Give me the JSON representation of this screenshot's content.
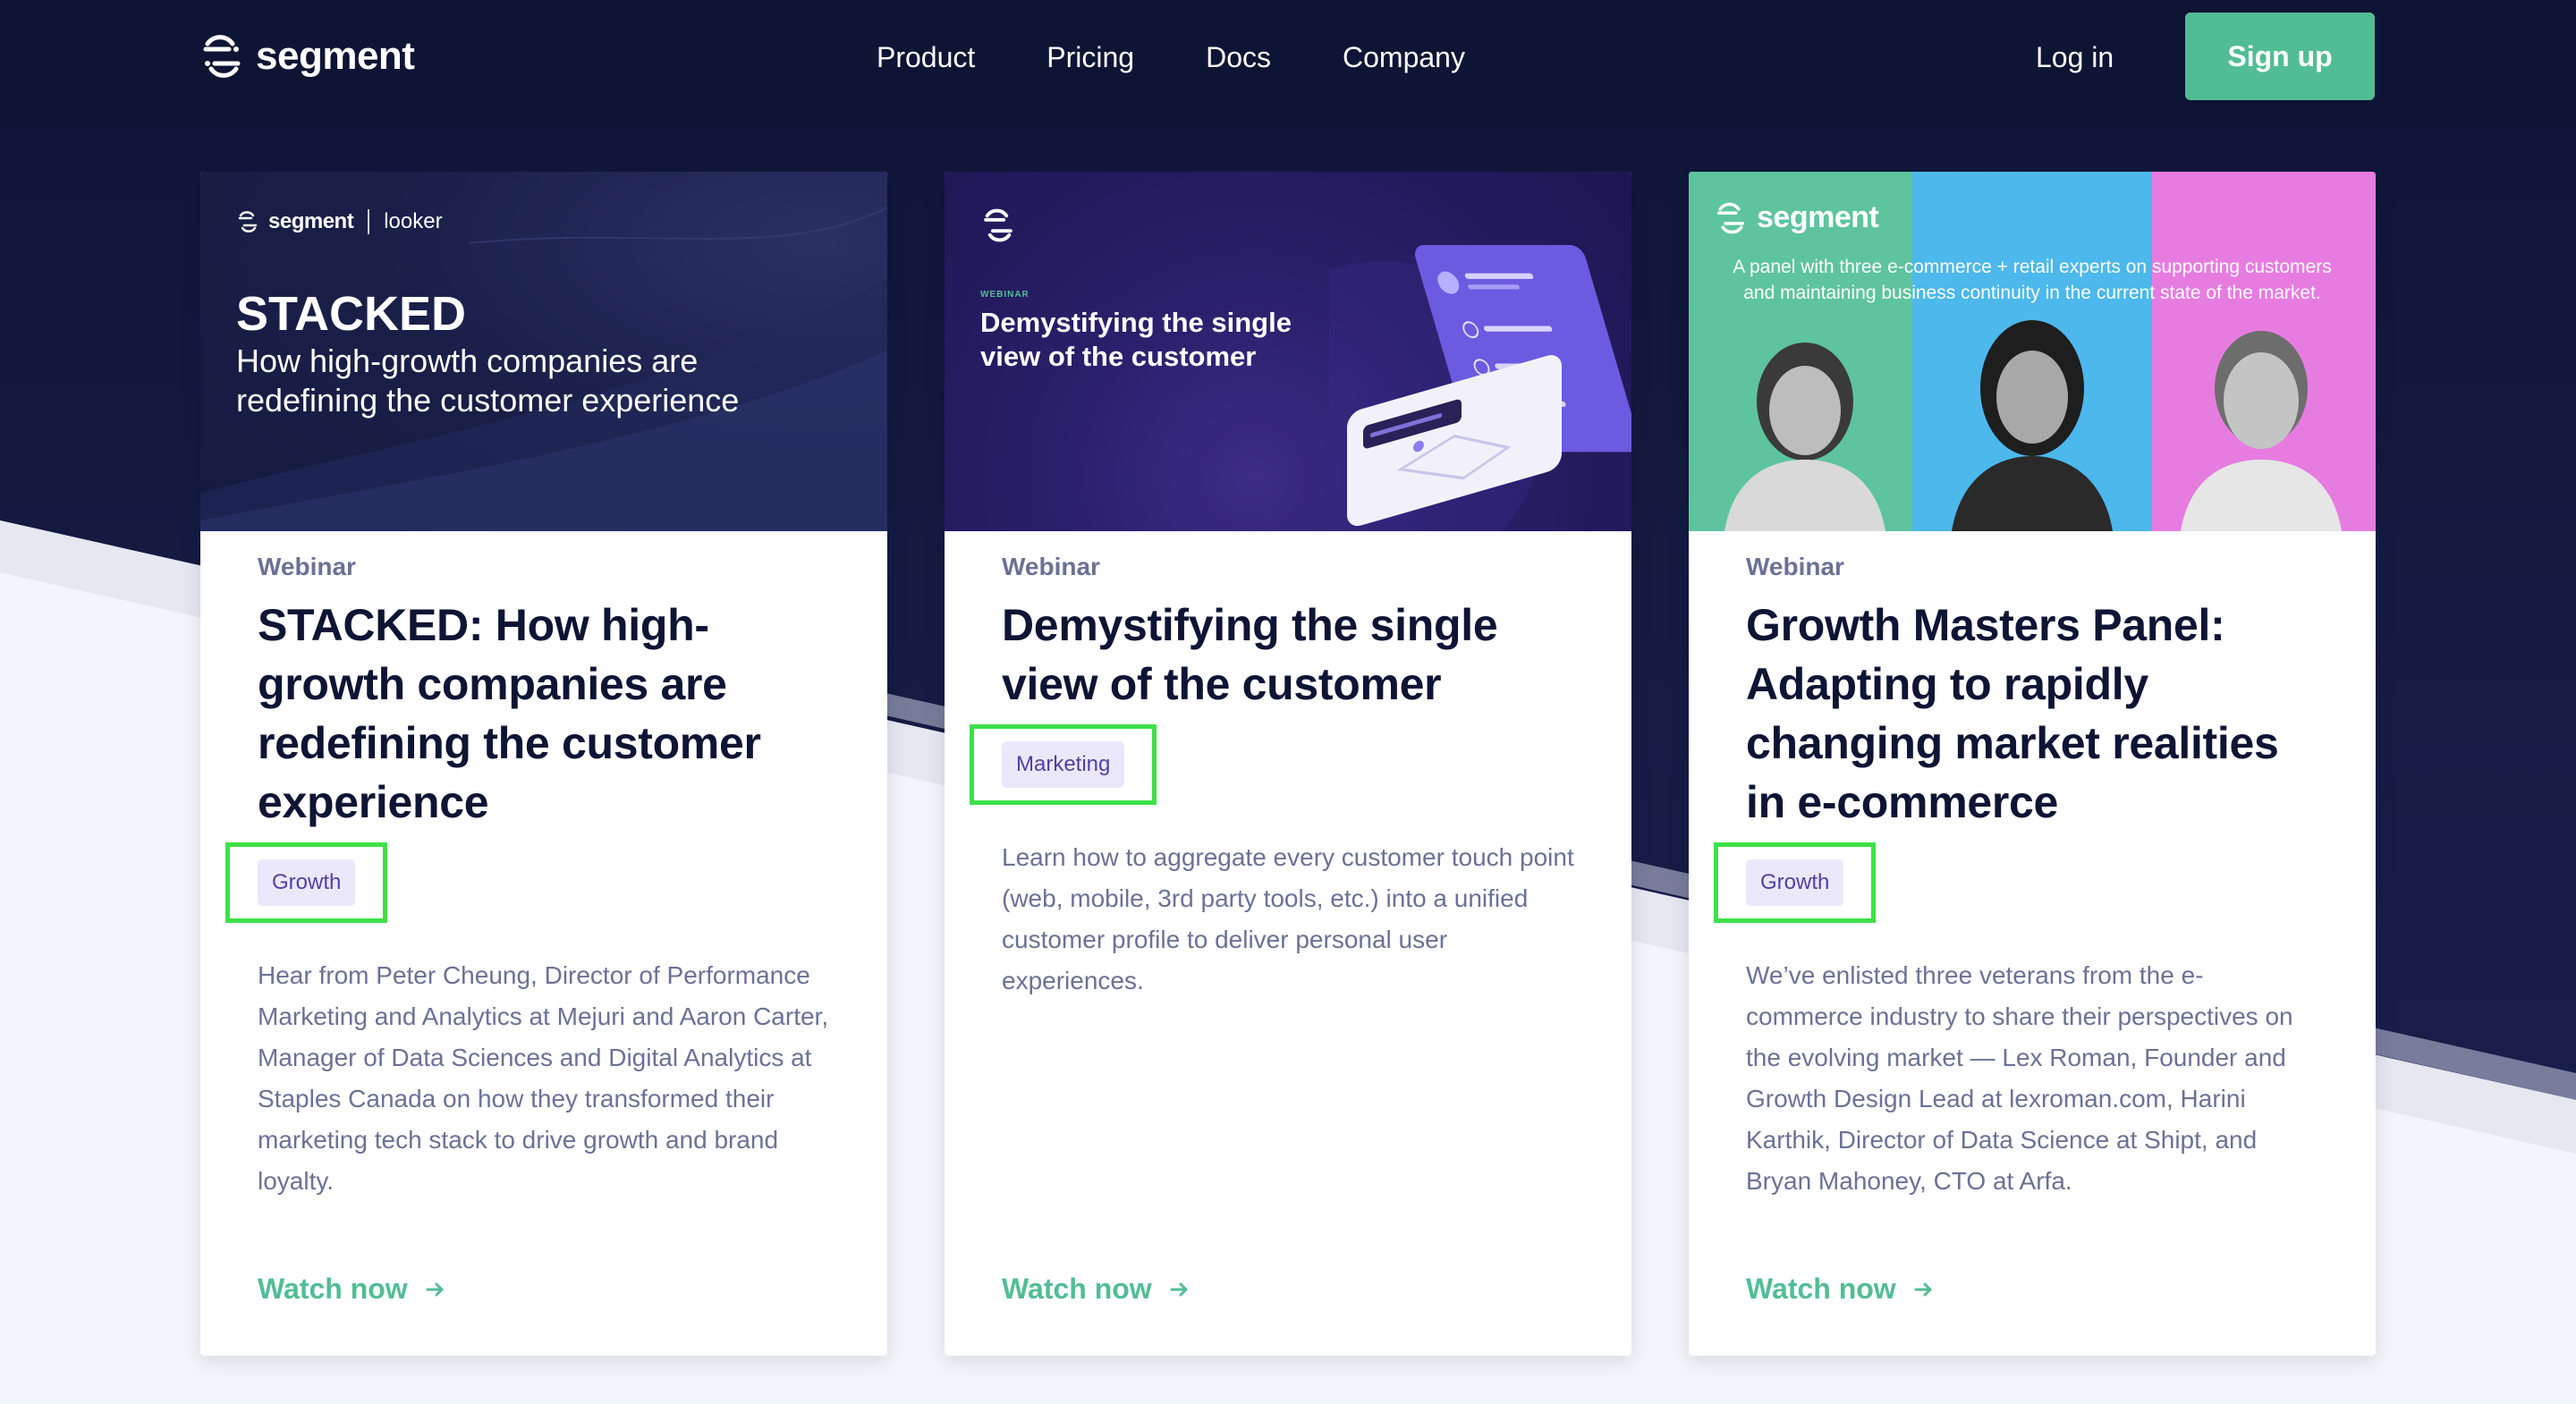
{
  "nav": {
    "brand": "segment",
    "links": [
      "Product",
      "Pricing",
      "Docs",
      "Company"
    ],
    "login": "Log in",
    "signup": "Sign up"
  },
  "colors": {
    "navy": "#0e1434",
    "accent_green": "#52bd94",
    "tag_bg": "#ece8fb",
    "tag_text": "#4f3fa8",
    "highlight": "#3ee047"
  },
  "cards": [
    {
      "thumb": {
        "brand": "segment",
        "partner": "looker",
        "headline": "STACKED",
        "subhead": "How high-growth companies are redefining the customer experience"
      },
      "eyebrow": "Webinar",
      "title": "STACKED: How high-growth companies are redefining the customer experience",
      "tag": "Growth",
      "description": "Hear from Peter Cheung, Director of Performance Marketing and Analytics at Mejuri and Aaron Carter, Manager of Data Sciences and Digital Analytics at Staples Canada on how they transformed their marketing tech stack to drive growth and brand loyalty.",
      "cta": "Watch now"
    },
    {
      "thumb": {
        "kicker": "WEBINAR",
        "headline": "Demystifying the single view of the customer"
      },
      "eyebrow": "Webinar",
      "title": "Demystifying the single view of the customer",
      "tag": "Marketing",
      "description": "Learn how to aggregate every customer touch point (web, mobile, 3rd party tools, etc.) into a unified customer profile to deliver personal user experiences.",
      "cta": "Watch now"
    },
    {
      "thumb": {
        "brand": "segment",
        "subhead": "A panel with three e-commerce + retail experts on supporting customers and maintaining business continuity in the current state of the market."
      },
      "eyebrow": "Webinar",
      "title": "Growth Masters Panel: Adapting to rapidly changing market realities in e-commerce",
      "tag": "Growth",
      "description": "We’ve enlisted three veterans from the e-commerce industry to share their perspectives on the evolving market — Lex Roman, Founder and Growth Design Lead at lexroman.com, Harini Karthik, Director of Data Science at Shipt, and Bryan Mahoney, CTO at Arfa.",
      "cta": "Watch now"
    }
  ]
}
